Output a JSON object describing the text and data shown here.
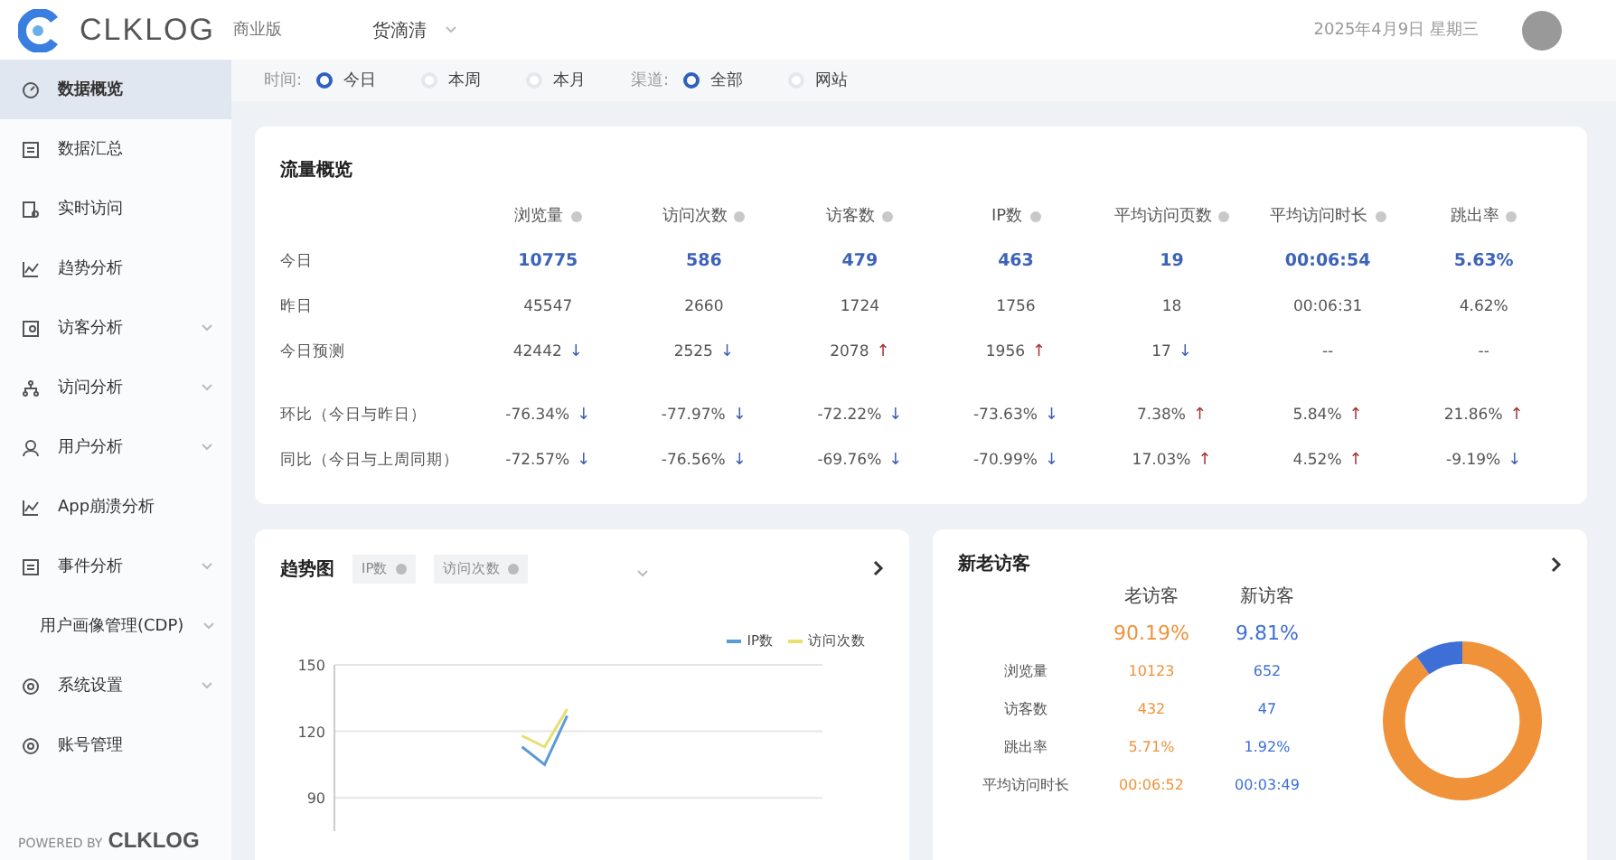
{
  "header": {
    "logo": "CLKLOG",
    "edition": "商业版",
    "project": "货滴清",
    "date": "2025年4月9日 星期三"
  },
  "sidebar": {
    "items": [
      {
        "label": "数据概览",
        "selected": true,
        "has_submenu": false
      },
      {
        "label": "数据汇总",
        "selected": false,
        "has_submenu": false
      },
      {
        "label": "实时访问",
        "selected": false,
        "has_submenu": false
      },
      {
        "label": "趋势分析",
        "selected": false,
        "has_submenu": false
      },
      {
        "label": "访客分析",
        "selected": false,
        "has_submenu": true
      },
      {
        "label": "访问分析",
        "selected": false,
        "has_submenu": true
      },
      {
        "label": "用户分析",
        "selected": false,
        "has_submenu": true
      },
      {
        "label": "App崩溃分析",
        "selected": false,
        "has_submenu": false
      },
      {
        "label": "事件分析",
        "selected": false,
        "has_submenu": true
      },
      {
        "label": "用户画像管理(CDP)",
        "selected": false,
        "has_submenu": true
      },
      {
        "label": "系统设置",
        "selected": false,
        "has_submenu": true
      },
      {
        "label": "账号管理",
        "selected": false,
        "has_submenu": false
      }
    ],
    "footer": {
      "prefix": "POWERED BY",
      "brand": "CLKLOG"
    }
  },
  "filters": [
    {
      "label": "时间:",
      "options": [
        {
          "label": "今日",
          "selected": true
        },
        {
          "label": "本周",
          "selected": false
        },
        {
          "label": "本月",
          "selected": false
        }
      ]
    },
    {
      "label": "渠道:",
      "options": [
        {
          "label": "全部",
          "selected": true
        },
        {
          "label": "网站",
          "selected": false
        }
      ]
    }
  ],
  "traffic": {
    "title": "流量概览",
    "columns": [
      "浏览量",
      "访问次数",
      "访客数",
      "IP数",
      "平均访问页数",
      "平均访问时长",
      "跳出率"
    ],
    "rows": [
      {
        "label": "今日",
        "emphasis": true,
        "cells": [
          {
            "value": "10775"
          },
          {
            "value": "586"
          },
          {
            "value": "479"
          },
          {
            "value": "463"
          },
          {
            "value": "19"
          },
          {
            "value": "00:06:54"
          },
          {
            "value": "5.63%"
          }
        ]
      },
      {
        "label": "昨日",
        "emphasis": false,
        "cells": [
          {
            "value": "45547"
          },
          {
            "value": "2660"
          },
          {
            "value": "1724"
          },
          {
            "value": "1756"
          },
          {
            "value": "18"
          },
          {
            "value": "00:06:31"
          },
          {
            "value": "4.62%"
          }
        ]
      },
      {
        "label": "今日预测",
        "emphasis": false,
        "cells": [
          {
            "value": "42442",
            "arrow": "↓",
            "color": "#3d5fb0"
          },
          {
            "value": "2525",
            "arrow": "↓",
            "color": "#3d5fb0"
          },
          {
            "value": "2078",
            "arrow": "↑",
            "color": "#a33333"
          },
          {
            "value": "1956",
            "arrow": "↑",
            "color": "#a33333"
          },
          {
            "value": "17",
            "arrow": "↓",
            "color": "#3d5fb0"
          },
          {
            "value": "--"
          },
          {
            "value": "--"
          }
        ]
      },
      {
        "label": "环比（今日与昨日）",
        "emphasis": false,
        "cells": [
          {
            "value": "-76.34%",
            "arrow": "↓",
            "color": "#3d5fb0"
          },
          {
            "value": "-77.97%",
            "arrow": "↓",
            "color": "#3d5fb0"
          },
          {
            "value": "-72.22%",
            "arrow": "↓",
            "color": "#3d5fb0"
          },
          {
            "value": "-73.63%",
            "arrow": "↓",
            "color": "#3d5fb0"
          },
          {
            "value": "7.38%",
            "arrow": "↑",
            "color": "#a33333"
          },
          {
            "value": "5.84%",
            "arrow": "↑",
            "color": "#a33333"
          },
          {
            "value": "21.86%",
            "arrow": "↑",
            "color": "#a33333"
          }
        ]
      },
      {
        "label": "同比（今日与上周同期）",
        "emphasis": false,
        "cells": [
          {
            "value": "-72.57%",
            "arrow": "↓",
            "color": "#3d5fb0"
          },
          {
            "value": "-76.56%",
            "arrow": "↓",
            "color": "#3d5fb0"
          },
          {
            "value": "-69.76%",
            "arrow": "↓",
            "color": "#3d5fb0"
          },
          {
            "value": "-70.99%",
            "arrow": "↓",
            "color": "#3d5fb0"
          },
          {
            "value": "17.03%",
            "arrow": "↑",
            "color": "#a33333"
          },
          {
            "value": "4.52%",
            "arrow": "↑",
            "color": "#a33333"
          },
          {
            "value": "-9.19%",
            "arrow": "↓",
            "color": "#3d5fb0"
          }
        ]
      }
    ]
  },
  "trend": {
    "title": "趋势图",
    "tags": [
      "IP数",
      "访问次数"
    ],
    "chart_data": {
      "type": "line",
      "ylim": [
        75,
        150
      ],
      "yticks": [
        90,
        120,
        150
      ],
      "series": [
        {
          "name": "IP数",
          "color": "#5b9bd5",
          "values": [
            null,
            null,
            null,
            null,
            null,
            null,
            null,
            null,
            113,
            105,
            127,
            null,
            null,
            null,
            null,
            null,
            null,
            null,
            null,
            null,
            null,
            null
          ]
        },
        {
          "name": "访问次数",
          "color": "#e8df70",
          "values": [
            null,
            null,
            null,
            null,
            null,
            null,
            null,
            null,
            118,
            113,
            130,
            null,
            null,
            null,
            null,
            null,
            null,
            null,
            null,
            null,
            null,
            null
          ]
        }
      ]
    }
  },
  "visitors": {
    "title": "新老访客",
    "columns": [
      {
        "name": "老访客",
        "share": "90.19%",
        "color": "#f0923a"
      },
      {
        "name": "新访客",
        "share": "9.81%",
        "color": "#3d6fd6"
      }
    ],
    "rows": [
      {
        "label": "浏览量",
        "values": [
          "10123",
          "652"
        ]
      },
      {
        "label": "访客数",
        "values": [
          "432",
          "47"
        ]
      },
      {
        "label": "跳出率",
        "values": [
          "5.71%",
          "1.92%"
        ]
      },
      {
        "label": "平均访问时长",
        "values": [
          "00:06:52",
          "00:03:49"
        ]
      }
    ],
    "chart_data": {
      "type": "donut",
      "values": [
        90.19,
        9.81
      ]
    }
  }
}
